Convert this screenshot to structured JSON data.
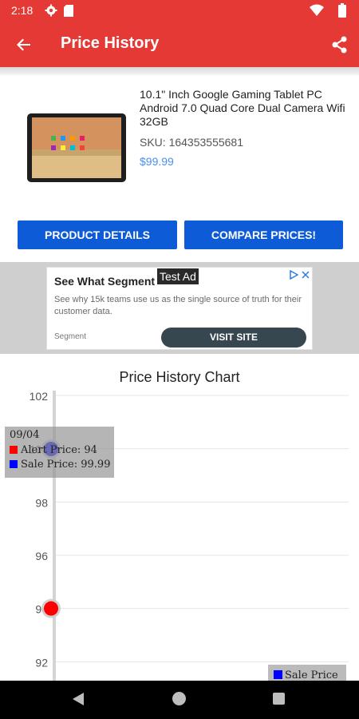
{
  "status_bar": {
    "time": "2:18"
  },
  "app_bar": {
    "title": "Price History"
  },
  "product": {
    "name": "10.1\" Inch Google Gaming Tablet PC Android 7.0 Quad Core Dual Camera Wifi 32GB",
    "sku": "SKU: 164353555681",
    "price": "$99.99"
  },
  "buttons": {
    "details": "PRODUCT DETAILS",
    "compare": "COMPARE PRICES!"
  },
  "ad": {
    "headline": "See What Segment",
    "label": "Test Ad",
    "description": "See why 15k teams use us as the single source of truth for their customer data.",
    "brand": "Segment",
    "cta": "VISIT SITE"
  },
  "colors": {
    "accent": "#e53935",
    "button": "#0d5bd6",
    "alert": "#ff0000",
    "sale": "#0000ff"
  },
  "chart_data": {
    "type": "line",
    "title": "Price History Chart",
    "x": [
      "09/04"
    ],
    "series": [
      {
        "name": "Alert Price",
        "values": [
          94
        ]
      },
      {
        "name": "Sale Price",
        "values": [
          99.99
        ]
      }
    ],
    "yticks": [
      92,
      94,
      96,
      98,
      100,
      102
    ],
    "ylim": [
      91.2,
      102.3
    ],
    "grid": true,
    "tooltip": {
      "date": "09/04",
      "alert_text": "Alert Price: 94",
      "sale_text": "Sale Price: 99.99"
    },
    "legend": {
      "position": "bottom-right",
      "label": "Sale Price"
    }
  }
}
